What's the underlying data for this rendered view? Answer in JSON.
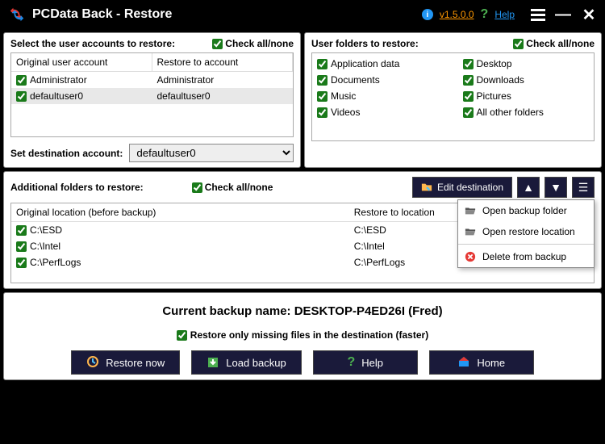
{
  "title": "PCData Back - Restore",
  "version": "v1.5.0.0",
  "help_link": "Help",
  "top_left": {
    "heading": "Select the user accounts to restore:",
    "check_all": "Check all/none",
    "col1": "Original user account",
    "col2": "Restore to account",
    "rows": [
      {
        "orig": "Administrator",
        "dest": "Administrator"
      },
      {
        "orig": "defaultuser0",
        "dest": "defaultuser0"
      }
    ],
    "dest_label": "Set destination account:",
    "dest_value": "defaultuser0"
  },
  "top_right": {
    "heading": "User folders to restore:",
    "check_all": "Check all/none",
    "items_left": [
      "Application data",
      "Documents",
      "Music",
      "Videos"
    ],
    "items_right": [
      "Desktop",
      "Downloads",
      "Pictures",
      "All other folders"
    ]
  },
  "middle": {
    "heading": "Additional folders to restore:",
    "check_all": "Check all/none",
    "edit_btn": "Edit destination",
    "col1": "Original location (before backup)",
    "col2": "Restore to location",
    "rows": [
      {
        "orig": "C:\\ESD",
        "dest": "C:\\ESD"
      },
      {
        "orig": "C:\\Intel",
        "dest": "C:\\Intel"
      },
      {
        "orig": "C:\\PerfLogs",
        "dest": "C:\\PerfLogs"
      }
    ],
    "menu": {
      "open_backup": "Open backup folder",
      "open_restore": "Open restore location",
      "delete": "Delete from backup"
    }
  },
  "bottom": {
    "backup_name": "Current backup name: DESKTOP-P4ED26I (Fred)",
    "restore_missing": "Restore only missing files in the destination (faster)",
    "restore_btn": "Restore now",
    "load_btn": "Load backup",
    "help_btn": "Help",
    "home_btn": "Home"
  }
}
